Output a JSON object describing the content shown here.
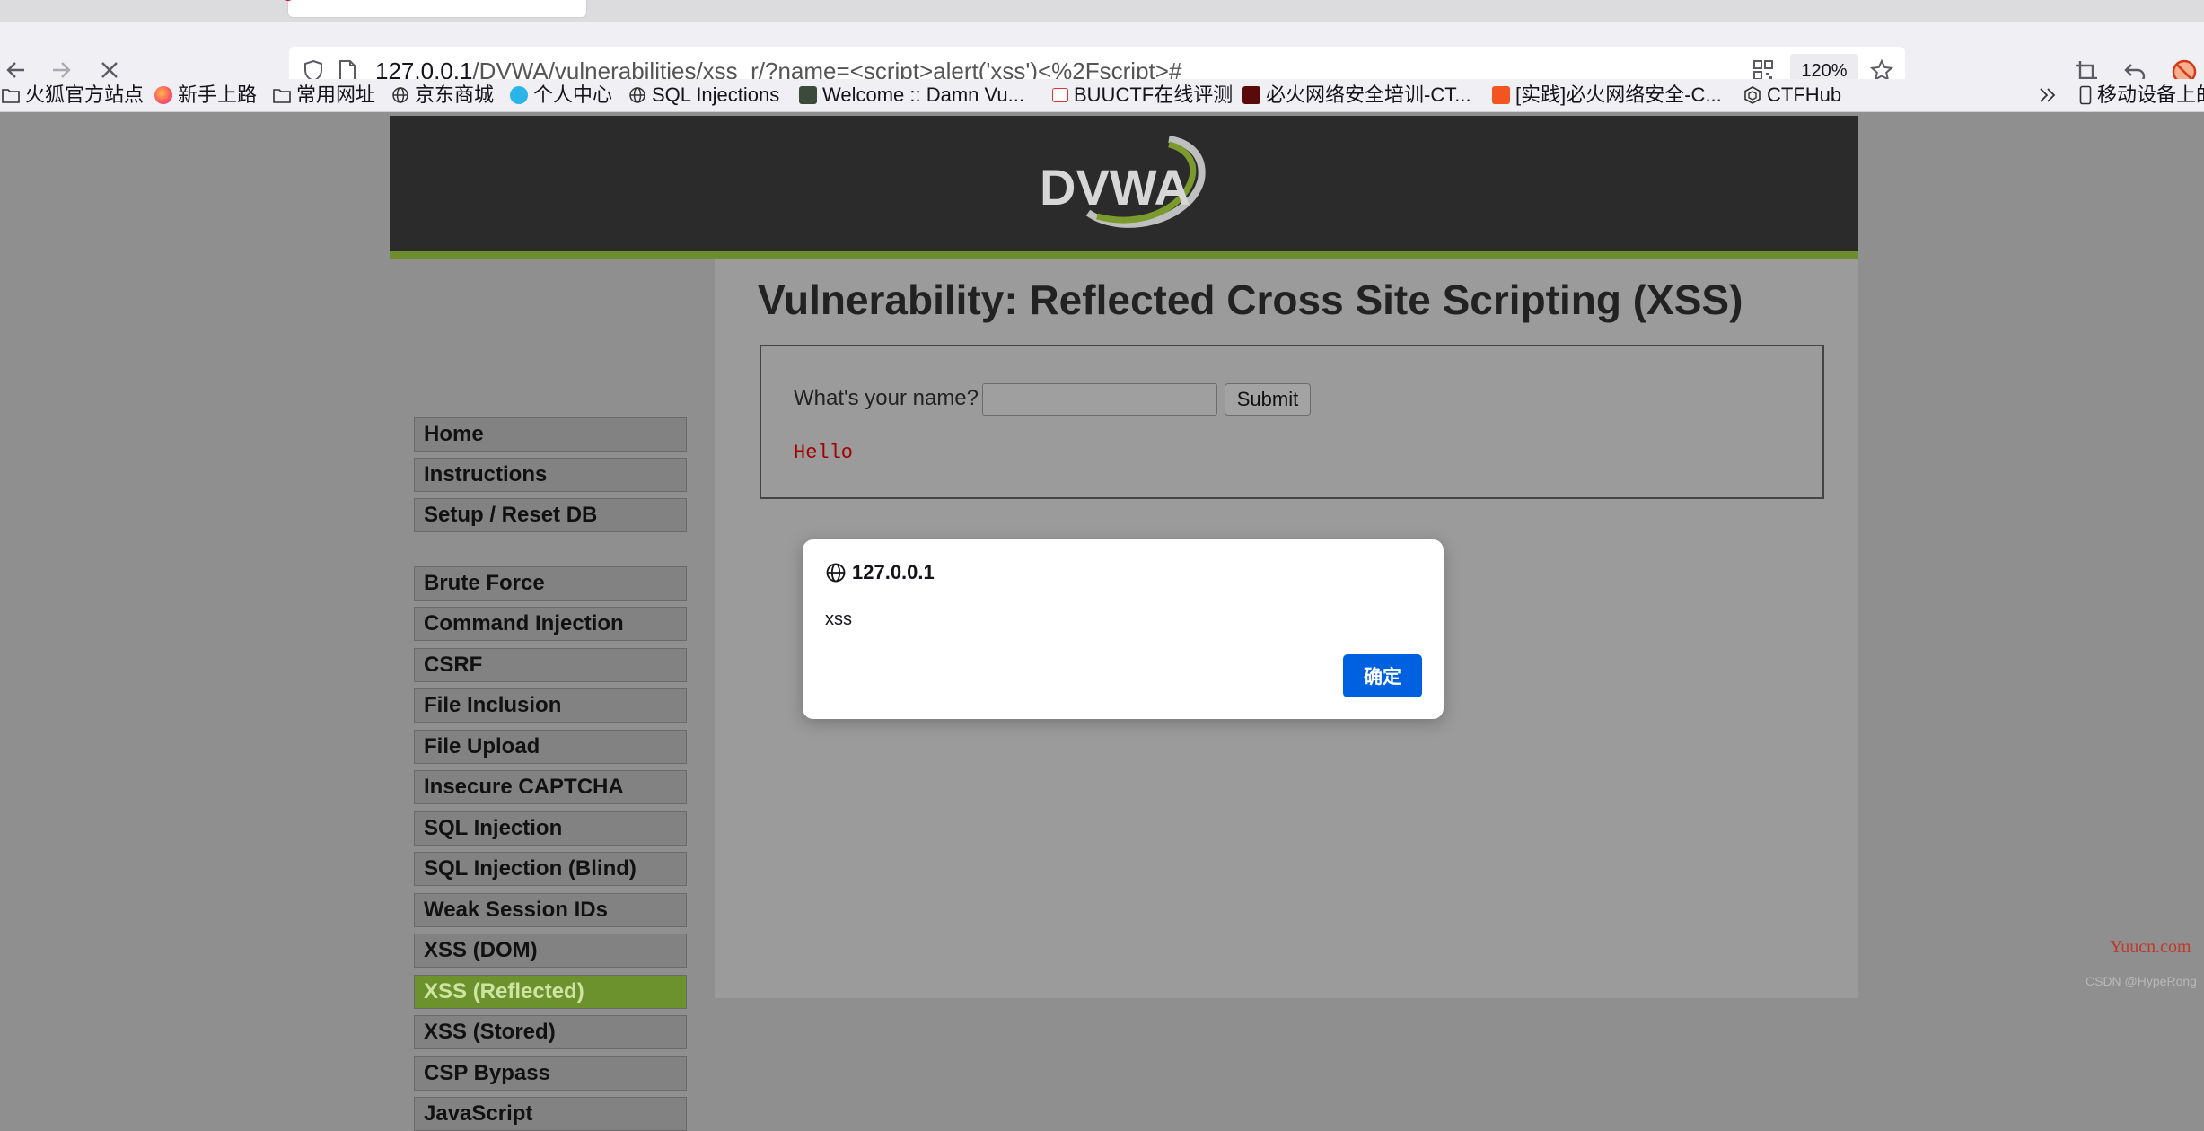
{
  "browser": {
    "url": {
      "host": "127.0.0.1",
      "path": "/DVWA/vulnerabilities/xss_r/?name=<script>alert('xss')<%2Fscript>#"
    },
    "zoom": "120%",
    "bookmarks": [
      {
        "label": "火狐官方站点",
        "icon": "folder-icon"
      },
      {
        "label": "新手上路",
        "icon": "firefox-icon"
      },
      {
        "label": "常用网址",
        "icon": "folder-icon"
      },
      {
        "label": "京东商城",
        "icon": "globe-icon"
      },
      {
        "label": "个人中心",
        "icon": "user-center-icon"
      },
      {
        "label": "SQL Injections",
        "icon": "globe-icon"
      },
      {
        "label": "Welcome :: Damn Vu...",
        "icon": "dvwa-icon"
      },
      {
        "label": "BUUCTF在线评测",
        "icon": "buuctf-icon"
      },
      {
        "label": "必火网络安全培训-CT...",
        "icon": "bihuo-icon"
      },
      {
        "label": "[实践]必火网络安全-C...",
        "icon": "csdn-icon"
      },
      {
        "label": "CTFHub",
        "icon": "ctfhub-icon"
      }
    ],
    "mobile_bookmarks": "移动设备上的"
  },
  "dvwa": {
    "logo_text": "DVWA",
    "title": "Vulnerability: Reflected Cross Site Scripting (XSS)",
    "menu": [
      {
        "label": "Home"
      },
      {
        "label": "Instructions"
      },
      {
        "label": "Setup / Reset DB"
      },
      {
        "label": "Brute Force"
      },
      {
        "label": "Command Injection"
      },
      {
        "label": "CSRF"
      },
      {
        "label": "File Inclusion"
      },
      {
        "label": "File Upload"
      },
      {
        "label": "Insecure CAPTCHA"
      },
      {
        "label": "SQL Injection"
      },
      {
        "label": "SQL Injection (Blind)"
      },
      {
        "label": "Weak Session IDs"
      },
      {
        "label": "XSS (DOM)"
      },
      {
        "label": "XSS (Reflected)",
        "active": true
      },
      {
        "label": "XSS (Stored)"
      },
      {
        "label": "CSP Bypass"
      },
      {
        "label": "JavaScript"
      }
    ],
    "form": {
      "label": "What's your name?",
      "input_value": "",
      "submit_label": "Submit",
      "output": "Hello"
    }
  },
  "dialog": {
    "origin": "127.0.0.1",
    "message": "xss",
    "ok_label": "确定"
  },
  "watermarks": {
    "site": "Yuucn.com",
    "author": "CSDN @HypeRong"
  },
  "colors": {
    "dvwa_green": "#6c922d",
    "header_bg": "#2b2b2b",
    "dialog_button": "#0061e0",
    "hello_red": "#a30000"
  }
}
